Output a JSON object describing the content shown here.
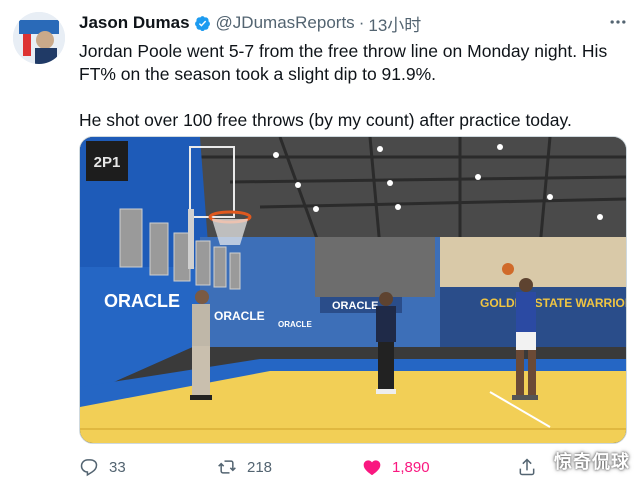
{
  "tweet": {
    "author_name": "Jason Dumas",
    "handle": "@JDumasReports",
    "separator": "·",
    "timestamp": "13小时",
    "paragraphs": [
      "Jordan Poole went 5-7 from the free throw line on Monday night. His FT% on the season took a slight dip to 91.9%.",
      "He shot over 100 free throws (by my count) after practice today."
    ]
  },
  "media": {
    "banner_1": "ORACLE",
    "banner_2": "ORACLE",
    "banner_3": "ORACLE",
    "banner_4": "ORACLE",
    "banner_5": "GOLDEN STATE WARRIORS",
    "scoreboard": "2P1"
  },
  "actions": {
    "replies": "33",
    "retweets": "218",
    "likes": "1,890"
  },
  "watermark": "惊奇侃球",
  "icons": {
    "verified": "verified-badge-icon",
    "more": "more-icon",
    "reply": "reply-icon",
    "retweet": "retweet-icon",
    "like": "heart-icon",
    "share": "share-icon"
  },
  "colors": {
    "verified": "#1d9bf0",
    "like": "#f91880",
    "secondary_text": "#536471",
    "court_floor": "#f2cf56",
    "court_wall": "#1e5bb8"
  }
}
